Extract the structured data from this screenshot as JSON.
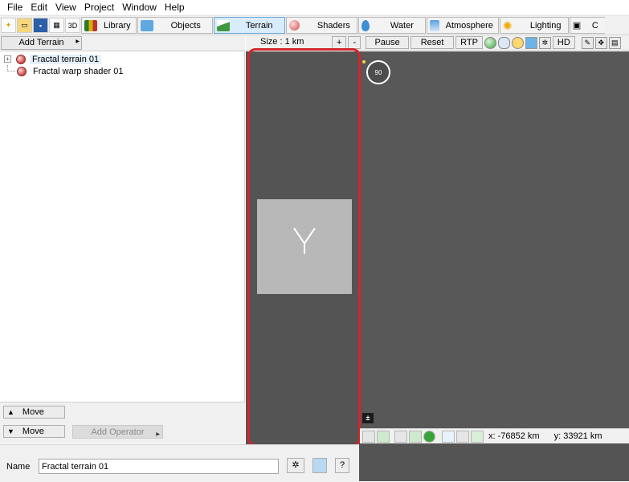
{
  "menu": [
    "File",
    "Edit",
    "View",
    "Project",
    "Window",
    "Help"
  ],
  "toolbar": {
    "tabs": [
      {
        "label": "Library",
        "icon": "library-icon"
      },
      {
        "label": "Objects",
        "icon": "objects-icon"
      },
      {
        "label": "Terrain",
        "icon": "terrain-icon",
        "active": true
      },
      {
        "label": "Shaders",
        "icon": "shaders-icon"
      },
      {
        "label": "Water",
        "icon": "water-icon"
      },
      {
        "label": "Atmosphere",
        "icon": "atmosphere-icon"
      },
      {
        "label": "Lighting",
        "icon": "lighting-icon"
      },
      {
        "label": "C",
        "icon": "cameras-icon"
      }
    ]
  },
  "left_panel": {
    "add_terrain": "Add Terrain",
    "tree": [
      {
        "label": "Fractal terrain 01",
        "expandable": true,
        "selected": true
      },
      {
        "label": "Fractal warp shader 01",
        "expandable": false,
        "selected": false
      }
    ],
    "move_up": "Move",
    "move_down": "Move",
    "add_operator": "Add Operator"
  },
  "viewport": {
    "size_label": "Size : 1 km",
    "plus": "+",
    "minus": "-",
    "pause": "Pause",
    "reset": "Reset",
    "rtp": "RTP",
    "hd": "HD",
    "compass": "90"
  },
  "status": {
    "x": "x: -76852 km",
    "y": "y: 33921 km"
  },
  "name_panel": {
    "label": "Name",
    "value": "Fractal terrain 01",
    "help": "?"
  },
  "colors": {
    "highlight": "#d1262a",
    "viewport": "#545454",
    "active_tab": "#d9ecfb"
  }
}
